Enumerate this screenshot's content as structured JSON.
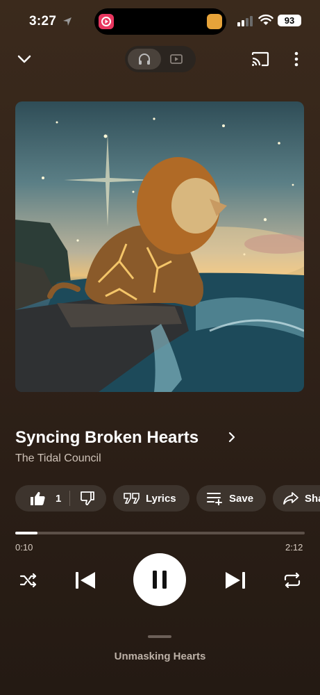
{
  "status": {
    "time": "3:27",
    "battery": "93"
  },
  "track": {
    "title": "Syncing Broken Hearts",
    "artist": "The Tidal Council"
  },
  "actions": {
    "like_count": "1",
    "lyrics_label": "Lyrics",
    "save_label": "Save",
    "share_label": "Share"
  },
  "progress": {
    "elapsed": "0:10",
    "duration": "2:12",
    "fraction": 0.076
  },
  "up_next": "Unmasking Hearts",
  "colors": {
    "background": "#33241a",
    "chip": "#3d342d",
    "accent": "#ffffff"
  }
}
